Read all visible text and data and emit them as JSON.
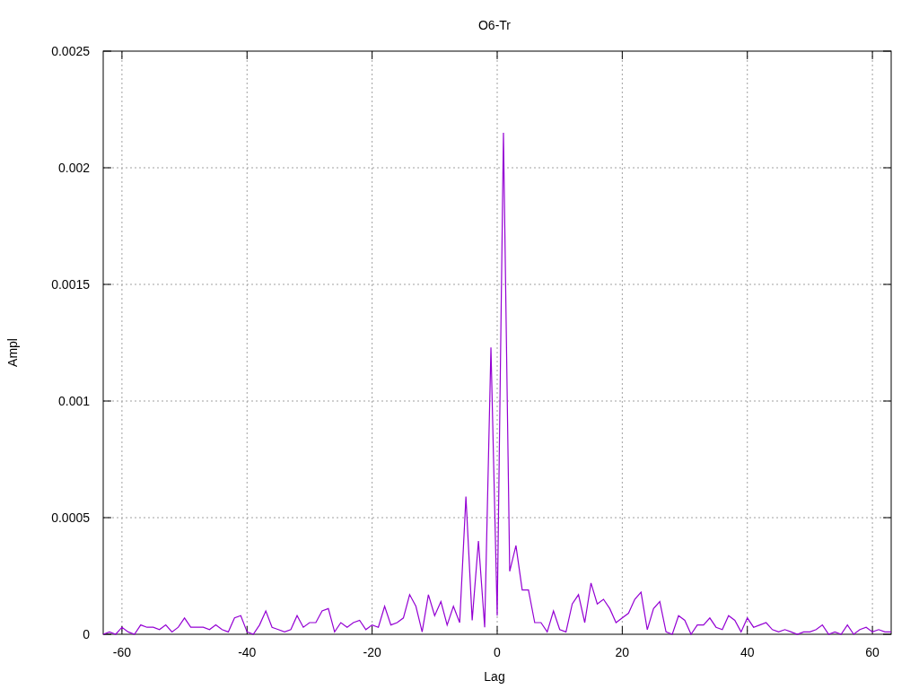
{
  "chart": {
    "chart_data": {
      "type": "line",
      "title": "O6-Tr",
      "xlabel": "Lag",
      "ylabel": "Ampl",
      "xlim": [
        -63,
        63
      ],
      "ylim": [
        0,
        0.0025
      ],
      "xticks": [
        -60,
        -40,
        -20,
        0,
        20,
        40,
        60
      ],
      "yticks": [
        0,
        0.0005,
        0.001,
        0.0015,
        0.002,
        0.0025
      ],
      "x": [
        -63,
        -62,
        -61,
        -60,
        -59,
        -58,
        -57,
        -56,
        -55,
        -54,
        -53,
        -52,
        -51,
        -50,
        -49,
        -48,
        -47,
        -46,
        -45,
        -44,
        -43,
        -42,
        -41,
        -40,
        -39,
        -38,
        -37,
        -36,
        -35,
        -34,
        -33,
        -32,
        -31,
        -30,
        -29,
        -28,
        -27,
        -26,
        -25,
        -24,
        -23,
        -22,
        -21,
        -20,
        -19,
        -18,
        -17,
        -16,
        -15,
        -14,
        -13,
        -12,
        -11,
        -10,
        -9,
        -8,
        -7,
        -6,
        -5,
        -4,
        -3,
        -2,
        -1,
        0,
        1,
        2,
        3,
        4,
        5,
        6,
        7,
        8,
        9,
        10,
        11,
        12,
        13,
        14,
        15,
        16,
        17,
        18,
        19,
        20,
        21,
        22,
        23,
        24,
        25,
        26,
        27,
        28,
        29,
        30,
        31,
        32,
        33,
        34,
        35,
        36,
        37,
        38,
        39,
        40,
        41,
        42,
        43,
        44,
        45,
        46,
        47,
        48,
        49,
        50,
        51,
        52,
        53,
        54,
        55,
        56,
        57,
        58,
        59,
        60,
        61,
        62,
        63
      ],
      "series": [
        {
          "color": "#9400d3",
          "values": [
            0,
            1e-05,
            0,
            3e-05,
            1e-05,
            0,
            4e-05,
            3e-05,
            3e-05,
            2e-05,
            4e-05,
            1e-05,
            3e-05,
            7e-05,
            3e-05,
            3e-05,
            3e-05,
            2e-05,
            4e-05,
            2e-05,
            1e-05,
            7e-05,
            8e-05,
            1e-05,
            0,
            4e-05,
            0.0001,
            3e-05,
            2e-05,
            1e-05,
            2e-05,
            8e-05,
            3e-05,
            5e-05,
            5e-05,
            0.0001,
            0.00011,
            1e-05,
            5e-05,
            3e-05,
            5e-05,
            6e-05,
            2e-05,
            4e-05,
            3e-05,
            0.00012,
            4e-05,
            5e-05,
            7e-05,
            0.00017,
            0.00012,
            1e-05,
            0.00017,
            8e-05,
            0.00014,
            4e-05,
            0.00012,
            5e-05,
            0.00059,
            6e-05,
            0.0004,
            3e-05,
            0.00123,
            8e-05,
            0.00215,
            0.00027,
            0.00038,
            0.00019,
            0.00019,
            5e-05,
            5e-05,
            1e-05,
            0.0001,
            2e-05,
            1e-05,
            0.00013,
            0.00017,
            5e-05,
            0.00022,
            0.00013,
            0.00015,
            0.00011,
            5e-05,
            7e-05,
            9e-05,
            0.00015,
            0.00018,
            2e-05,
            0.00011,
            0.00014,
            1e-05,
            0,
            8e-05,
            6e-05,
            0,
            4e-05,
            4e-05,
            7e-05,
            3e-05,
            2e-05,
            8e-05,
            6e-05,
            1e-05,
            7e-05,
            3e-05,
            4e-05,
            5e-05,
            2e-05,
            1e-05,
            2e-05,
            1e-05,
            0,
            1e-05,
            1e-05,
            2e-05,
            4e-05,
            0,
            1e-05,
            0,
            4e-05,
            0,
            2e-05,
            3e-05,
            1e-05,
            2e-05,
            1e-05,
            1e-05
          ]
        }
      ],
      "grid": true
    }
  }
}
